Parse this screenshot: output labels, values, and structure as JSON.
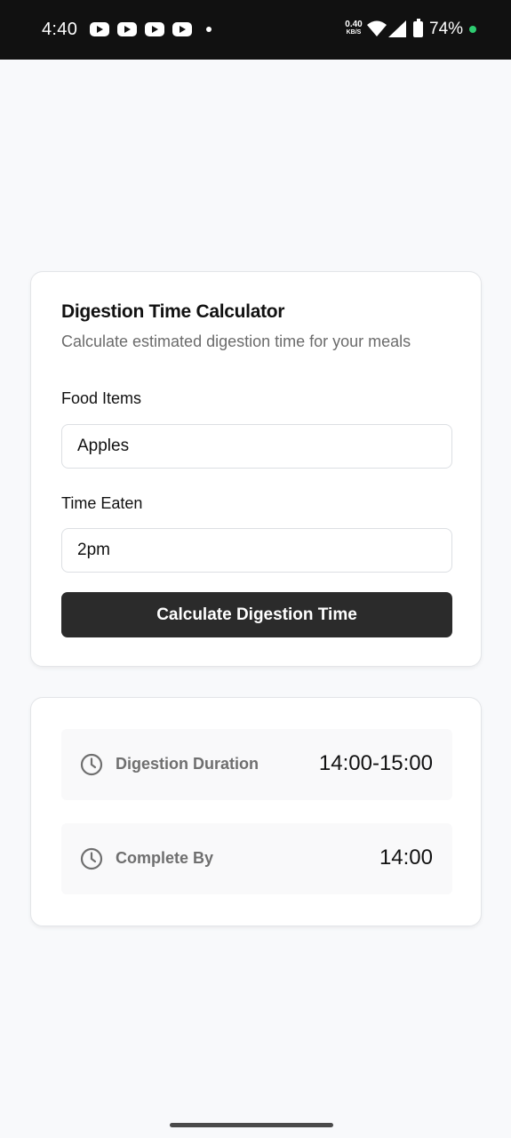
{
  "status_bar": {
    "time": "4:40",
    "net_speed_value": "0.40",
    "net_speed_unit": "KB/S",
    "battery": "74%",
    "notification_icons": [
      "youtube-icon",
      "youtube-icon",
      "youtube-icon",
      "youtube-icon"
    ]
  },
  "calculator": {
    "title": "Digestion Time Calculator",
    "subtitle": "Calculate estimated digestion time for your meals",
    "food_label": "Food Items",
    "food_value": "Apples",
    "time_label": "Time Eaten",
    "time_value": "2pm",
    "button_label": "Calculate Digestion Time"
  },
  "results": {
    "duration_label": "Digestion Duration",
    "duration_value": "14:00-15:00",
    "complete_label": "Complete By",
    "complete_value": "14:00"
  },
  "colors": {
    "button_bg": "#2b2b2b",
    "page_bg": "#f8f9fb",
    "status_bar_bg": "#111111",
    "charging_dot": "#2ecc71"
  }
}
